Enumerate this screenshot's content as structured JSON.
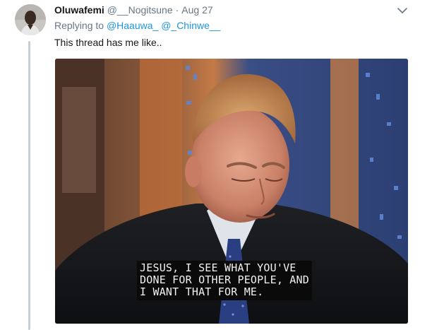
{
  "tweet": {
    "display_name": "Oluwafemi",
    "handle": "@__Nogitsune",
    "separator": "·",
    "timestamp": "Aug 27",
    "replying_prefix": "Replying to",
    "reply_to": [
      "@Haauwa_",
      "@_Chinwe__"
    ],
    "text": "This thread has me like..",
    "menu_icon": "chevron-down-icon"
  },
  "media": {
    "caption_lines": [
      "JESUS, I SEE WHAT YOU'VE",
      "DONE FOR OTHER PEOPLE, AND",
      "I WANT THAT FOR ME."
    ]
  },
  "colors": {
    "link": "#1b95e0",
    "secondary_text": "#657786",
    "thread_line": "#c4cfd6"
  }
}
